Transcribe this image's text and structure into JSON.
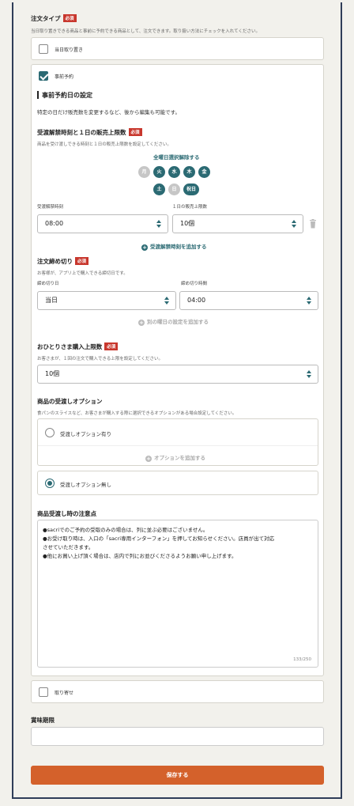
{
  "order_type": {
    "label": "注文タイプ",
    "required_badge": "必須",
    "hint": "当日取り置きできる商品と事前に予約できる商品として、注文できます。取り扱い方法にチェックを入れてください。",
    "options": [
      {
        "label": "当日取り置き",
        "checked": false
      },
      {
        "label": "事前予約",
        "checked": true
      },
      {
        "label": "取り寄せ",
        "checked": false
      }
    ]
  },
  "reservation": {
    "heading": "事前予約日の設定",
    "desc": "特定の日だけ販売数を変更するなど、後から編集も可能です。",
    "pickup_block": {
      "label": "受渡解禁時刻と１日の販売上限数",
      "required_badge": "必須",
      "hint": "商品を受け渡しできる時刻と１日の販売上限数を設定してください。",
      "select_all_link": "全曜日選択解除する",
      "days": [
        {
          "label": "月",
          "on": false
        },
        {
          "label": "火",
          "on": true
        },
        {
          "label": "水",
          "on": true
        },
        {
          "label": "木",
          "on": true
        },
        {
          "label": "金",
          "on": true
        },
        {
          "label": "土",
          "on": true
        },
        {
          "label": "日",
          "on": false
        },
        {
          "label": "祝日",
          "on": true
        }
      ],
      "time_label": "受渡解禁時刻",
      "time_value": "08:00",
      "limit_label": "１日の販売上限数",
      "limit_value": "10個",
      "add_link": "受渡解禁時刻を追加する"
    },
    "deadline_block": {
      "label": "注文締め切り",
      "required_badge": "必須",
      "hint": "お客様が、アプリ上で購入できる締切日です。",
      "day_label": "締め切り日",
      "day_value": "当日",
      "time_label": "締め切り時間",
      "time_value": "04:00",
      "add_link": "別の曜日の設定を追加する"
    },
    "per_customer": {
      "label": "おひとりさま購入上限数",
      "required_badge": "必須",
      "hint": "お客さまが、１回の注文で購入できる上限を設定してください。",
      "value": "10個"
    },
    "handover_option": {
      "label": "商品の受渡しオプション",
      "hint": "食パンのスライスなど、お客さまが購入する際に選択できるオプションがある場合設定してください。",
      "options": [
        {
          "label": "受渡しオプション有り",
          "selected": false
        },
        {
          "label": "受渡しオプション無し",
          "selected": true
        }
      ],
      "add_link": "オプションを追加する"
    },
    "notes": {
      "label": "商品受渡し時の注意点",
      "lines": [
        "●sacriでのご予約の受取のみの場合は、列に並ぶ必要はございません。",
        "●お受け取り時は、入口の「sacri専用インターフォン」を押してお知らせください。店員が出て対応",
        "させていただきます。",
        "●他にお買い上げ頂く場合は、店内で列にお並びくださるようお願い申し上げます。"
      ],
      "counter": "133/250"
    }
  },
  "expiry": {
    "label": "賞味期限",
    "value": ""
  },
  "save_button": "保存する",
  "colors": {
    "accent": "#2b6a73",
    "required": "#c8372d",
    "save": "#d4612b",
    "frame": "#2f3d58"
  }
}
